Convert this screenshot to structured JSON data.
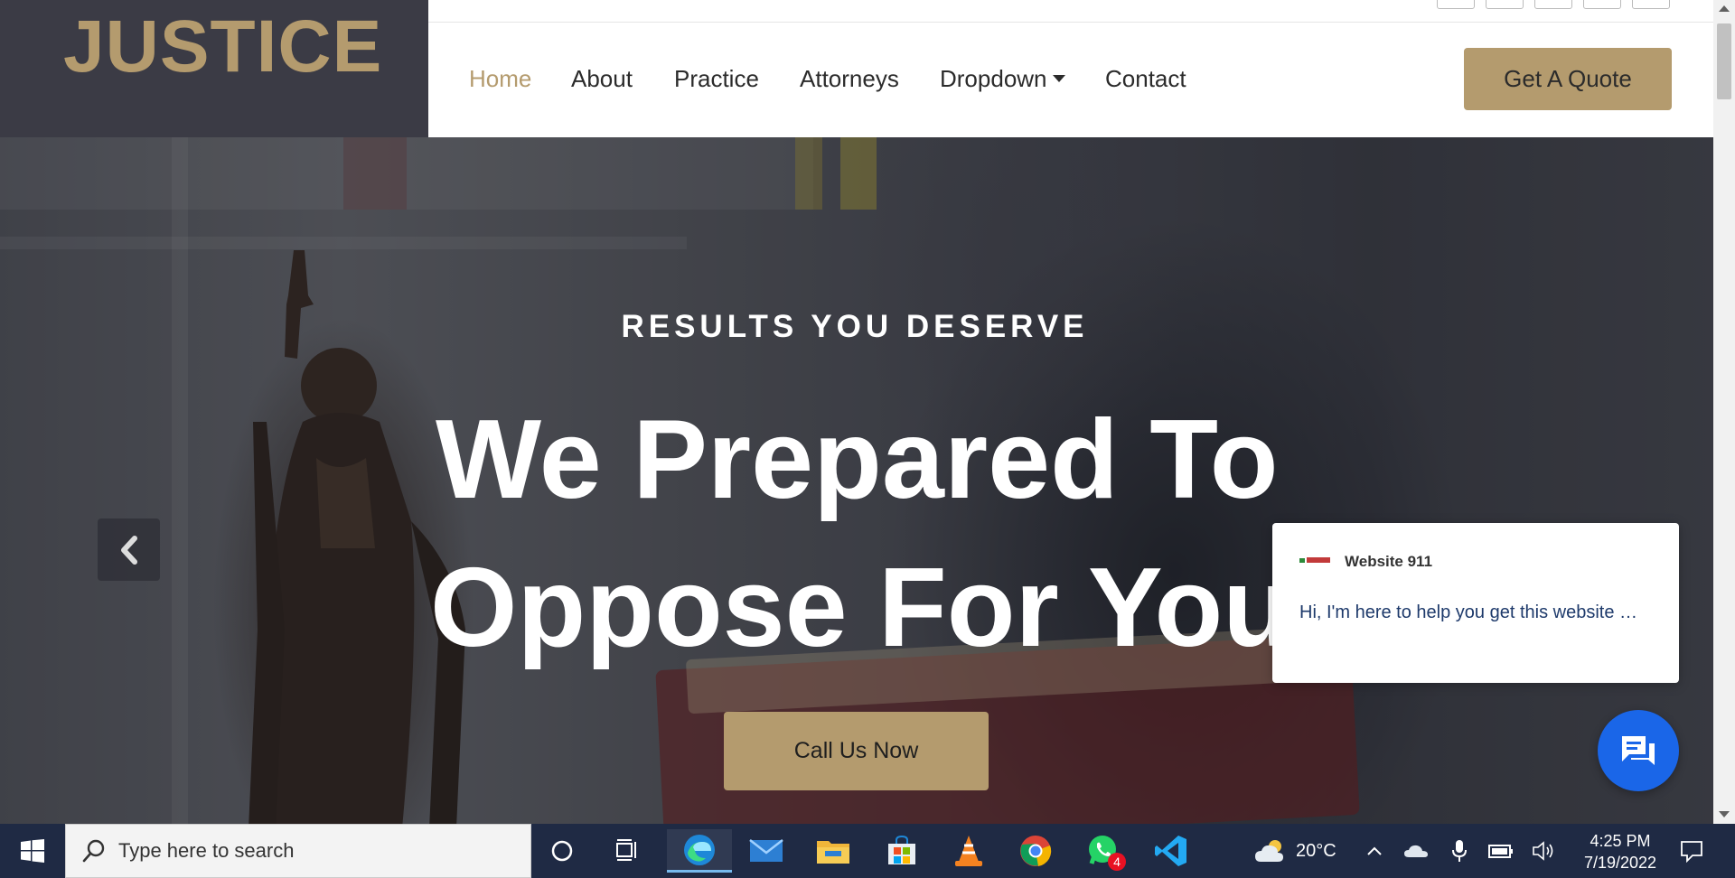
{
  "logo": {
    "text": "JUSTICE"
  },
  "nav": {
    "items": [
      {
        "label": "Home",
        "active": true
      },
      {
        "label": "About"
      },
      {
        "label": "Practice"
      },
      {
        "label": "Attorneys"
      },
      {
        "label": "Dropdown"
      },
      {
        "label": "Contact"
      }
    ],
    "quote_button": "Get A Quote"
  },
  "hero": {
    "kicker": "RESULTS YOU DESERVE",
    "title_line1": "We Prepared To",
    "title_line2": "Oppose For You",
    "cta_button": "Call Us Now"
  },
  "chat": {
    "name": "Website 911",
    "message": "Hi, I'm here to help you get this website …"
  },
  "taskbar": {
    "search_placeholder": "Type here to search",
    "weather": "20°C",
    "time": "4:25 PM",
    "date": "7/19/2022",
    "whatsapp_badge": "4"
  },
  "colors": {
    "accent": "#b49b6e",
    "logo_bg": "#3b3b45",
    "chat_blue": "#1a66e8",
    "taskbar": "#1f2a44"
  }
}
